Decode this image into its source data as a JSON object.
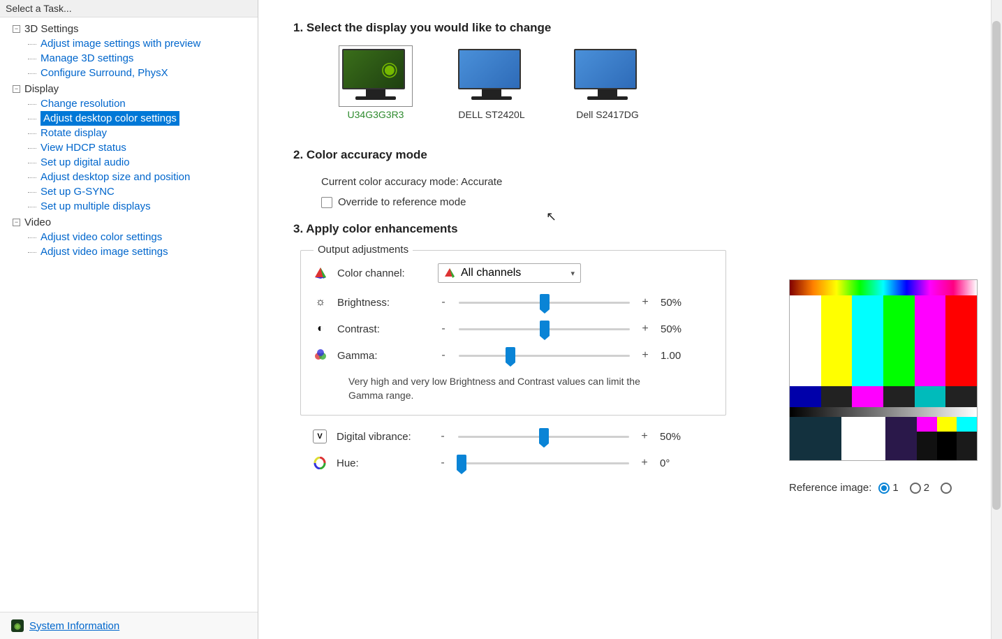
{
  "sidebar": {
    "header": "Select a Task...",
    "groups": [
      {
        "label": "3D Settings",
        "expanded": true,
        "items": [
          "Adjust image settings with preview",
          "Manage 3D settings",
          "Configure Surround, PhysX"
        ]
      },
      {
        "label": "Display",
        "expanded": true,
        "items": [
          "Change resolution",
          "Adjust desktop color settings",
          "Rotate display",
          "View HDCP status",
          "Set up digital audio",
          "Adjust desktop size and position",
          "Set up G-SYNC",
          "Set up multiple displays"
        ],
        "selected_index": 1
      },
      {
        "label": "Video",
        "expanded": true,
        "items": [
          "Adjust video color settings",
          "Adjust video image settings"
        ]
      }
    ],
    "footer_link": "System Information"
  },
  "main": {
    "step1_title": "1. Select the display you would like to change",
    "displays": [
      {
        "name": "U34G3G3R3",
        "selected": true
      },
      {
        "name": "DELL ST2420L",
        "selected": false
      },
      {
        "name": "Dell S2417DG",
        "selected": false
      }
    ],
    "step2_title": "2. Color accuracy mode",
    "current_mode_label": "Current color accuracy mode: ",
    "current_mode_value": "Accurate",
    "override_label": "Override to reference mode",
    "step3_title": "3. Apply color enhancements",
    "output_legend": "Output adjustments",
    "color_channel_label": "Color channel:",
    "color_channel_value": "All channels",
    "sliders": {
      "brightness": {
        "label": "Brightness:",
        "value": "50%",
        "pos": 50
      },
      "contrast": {
        "label": "Contrast:",
        "value": "50%",
        "pos": 50
      },
      "gamma": {
        "label": "Gamma:",
        "value": "1.00",
        "pos": 30
      }
    },
    "gamma_hint": "Very high and very low Brightness and Contrast values can limit the Gamma range.",
    "outer_sliders": {
      "vibrance": {
        "label": "Digital vibrance:",
        "value": "50%",
        "pos": 50
      },
      "hue": {
        "label": "Hue:",
        "value": "0°",
        "pos": 2
      }
    },
    "reference_label": "Reference image:",
    "reference_options": [
      "1",
      "2"
    ],
    "reference_selected": 0
  }
}
